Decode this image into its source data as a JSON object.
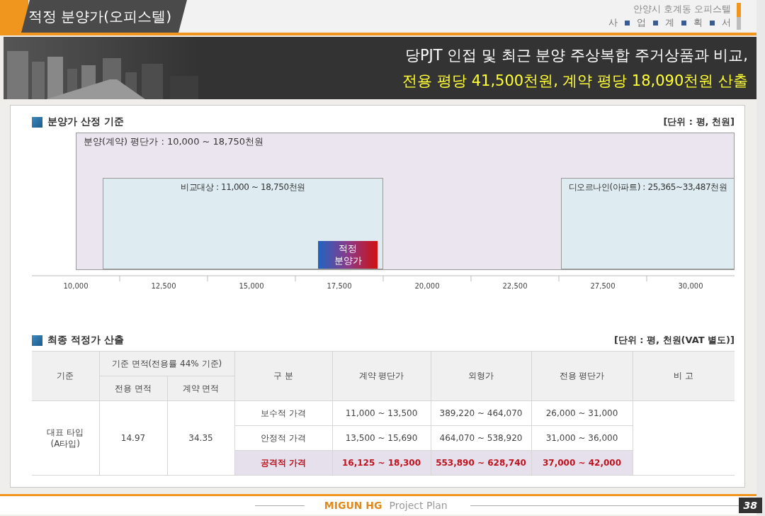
{
  "header": {
    "title": "적정 분양가(오피스텔)",
    "project": "안양시 호계동 오피스텔",
    "subtitle_chars": [
      "사",
      "업",
      "계",
      "획",
      "서"
    ]
  },
  "banner": {
    "line_1": "당PJT 인접 및 최근 분양 주상복합 주거상품과 비교,",
    "line_2": "전용 평당 41,500천원, 계약 평당 18,090천원 산출"
  },
  "section_1": {
    "title": "분양가 산정 기준",
    "unit": "[단위 : 평, 천원]",
    "ranges": [
      {
        "kind": "outer",
        "label": "분양(계약) 평단가 : 10,000 ~ 18,750천원"
      },
      {
        "kind": "band",
        "label": "비교대상 : 11,000 ~ 18,750천원"
      },
      {
        "kind": "band",
        "label": "디오르나인(아파트) : 25,365~33,487천원"
      },
      {
        "kind": "marker",
        "label": "적정\n분양가"
      }
    ],
    "ticks": [
      "10,000",
      "12,500",
      "15,000",
      "17,500",
      "20,000",
      "22,500",
      "27,500",
      "30,000"
    ]
  },
  "section_2": {
    "title": "최종 적정가 산출",
    "unit": "[단위 : 평, 천원(VAT 별도)]",
    "table": {
      "columns": [
        "기준",
        "기준 면적(전용률 44% 기준)",
        "전용 면적",
        "계약 면적",
        "구 분",
        "계약 평단가",
        "외형가",
        "전용 평단가",
        "비 고"
      ],
      "type": "대표 타입\n(A타입)",
      "net_area": "14.97",
      "contract_area": "34.35",
      "rows": [
        {
          "label": "보수적 가격",
          "values": [
            "11,000 ~ 13,500",
            "389,220 ~ 464,070",
            "26,000 ~ 31,000"
          ],
          "emphasized": false
        },
        {
          "label": "안정적 가격",
          "values": [
            "13,500 ~ 15,690",
            "464,070 ~ 538,920",
            "31,000 ~ 36,000"
          ],
          "emphasized": false
        },
        {
          "label": "공격적 가격",
          "values": [
            "16,125 ~ 18,300",
            "553,890 ~ 628,740",
            "37,000 ~ 42,000"
          ],
          "emphasized": true
        }
      ]
    }
  },
  "footer": {
    "brand": "MIGUN HG",
    "label": "Project Plan",
    "page": "38"
  }
}
